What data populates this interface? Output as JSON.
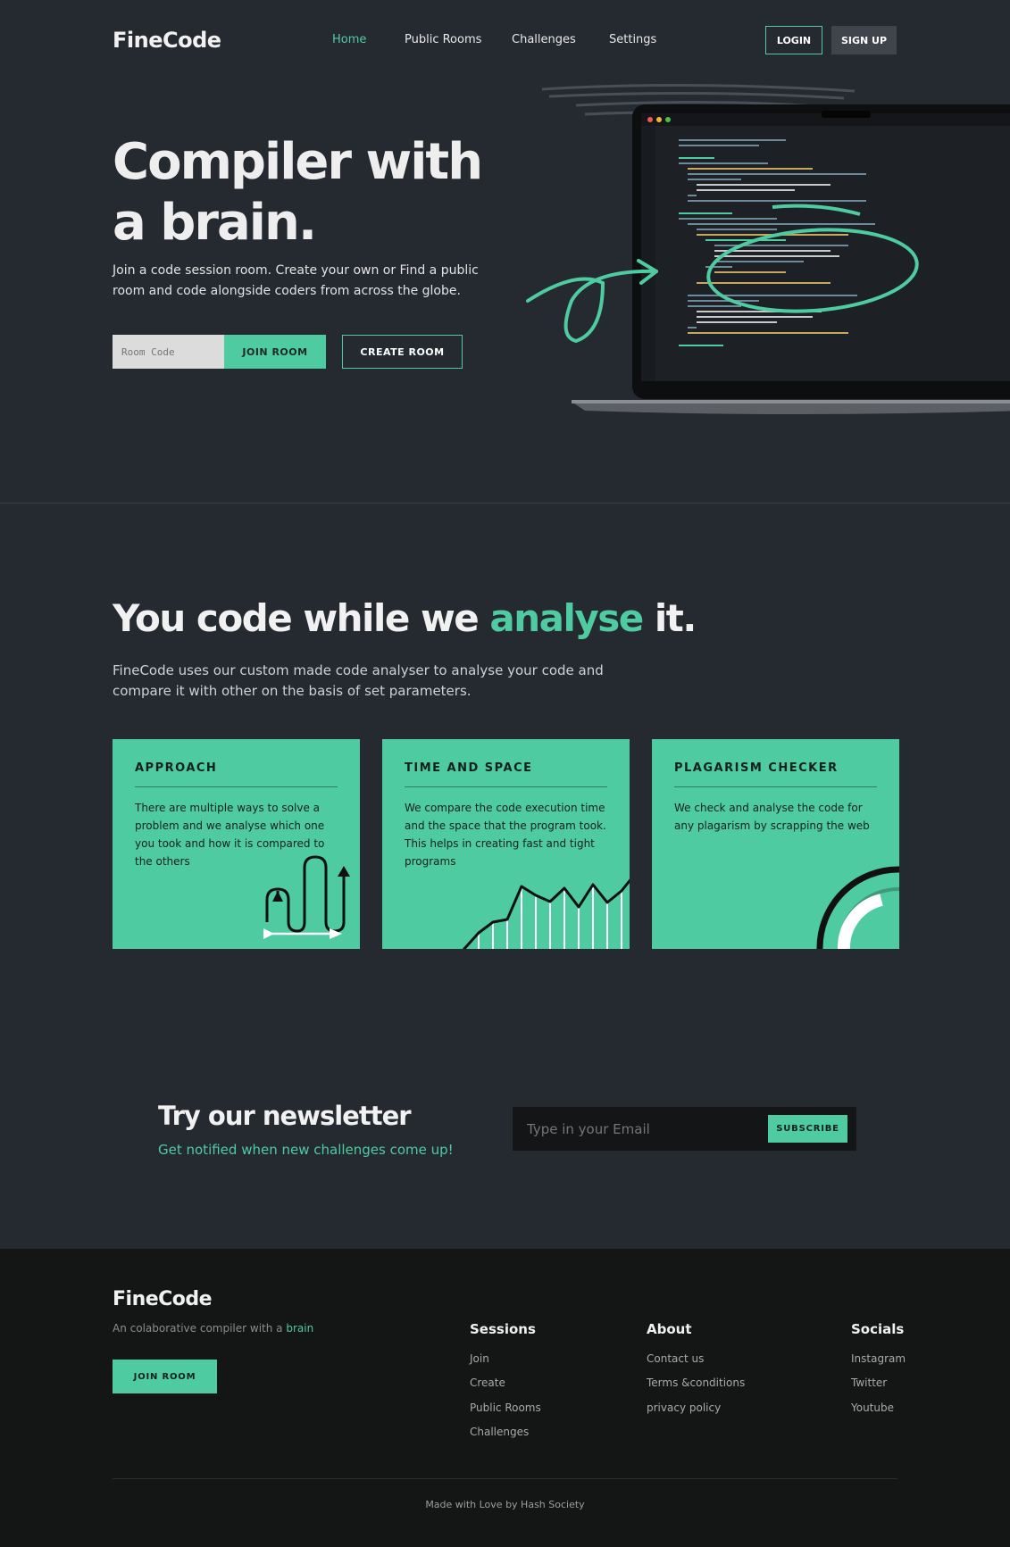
{
  "brand": {
    "name": "FineCode",
    "accent": "#4ecba0",
    "bg": "#252a31",
    "footer_bg": "#141515"
  },
  "nav": {
    "items": [
      {
        "label": "Home",
        "active": true
      },
      {
        "label": "Public Rooms",
        "active": false
      },
      {
        "label": "Challenges",
        "active": false
      },
      {
        "label": "Settings",
        "active": false
      }
    ],
    "login_label": "LOGIN",
    "signup_label": "SIGN UP"
  },
  "hero": {
    "title_line1": "Compiler with",
    "title_line2": "a brain.",
    "subtitle": "Join a code session room. Create your own or Find a public room and code alongside coders from across the globe.",
    "room_code_placeholder": "Room Code",
    "join_label": "JOIN ROOM",
    "create_label": "CREATE ROOM"
  },
  "analyse": {
    "title_before": "You code while we ",
    "title_highlight": "analyse",
    "title_after": " it.",
    "subtitle": "FineCode uses our custom made code analyser to analyse your code and compare it with other on the basis of set parameters.",
    "cards": [
      {
        "title": "APPROACH",
        "text": "There are multiple ways to solve a problem and we analyse which one you took and how it is compared to the others",
        "icon": "path-arrows-icon"
      },
      {
        "title": "TIME AND SPACE",
        "text": "We compare the code execution time and the space that the program took. This helps in creating fast and tight programs",
        "icon": "line-graph-icon"
      },
      {
        "title": "PLAGARISM CHECKER",
        "text": "We check and analyse the code for any plagarism by scrapping the web",
        "icon": "arc-gauge-icon"
      }
    ]
  },
  "newsletter": {
    "title": "Try our newsletter",
    "subtitle": "Get notified when new challenges come up!",
    "email_placeholder": "Type in your Email",
    "subscribe_label": "SUBSCRIBE"
  },
  "footer": {
    "logo": "FineCode",
    "tagline_before": "An colaborative compiler with a ",
    "tagline_highlight": "brain",
    "join_label": "JOIN ROOM",
    "columns": [
      {
        "title": "Sessions",
        "links": [
          "Join",
          "Create",
          "Public Rooms",
          "Challenges"
        ]
      },
      {
        "title": "About",
        "links": [
          "Contact us",
          "Terms &conditions",
          "privacy policy"
        ]
      },
      {
        "title": "Socials",
        "links": [
          "Instagram",
          "Twitter",
          "Youtube"
        ]
      }
    ],
    "credit": "Made with Love by Hash Society"
  }
}
